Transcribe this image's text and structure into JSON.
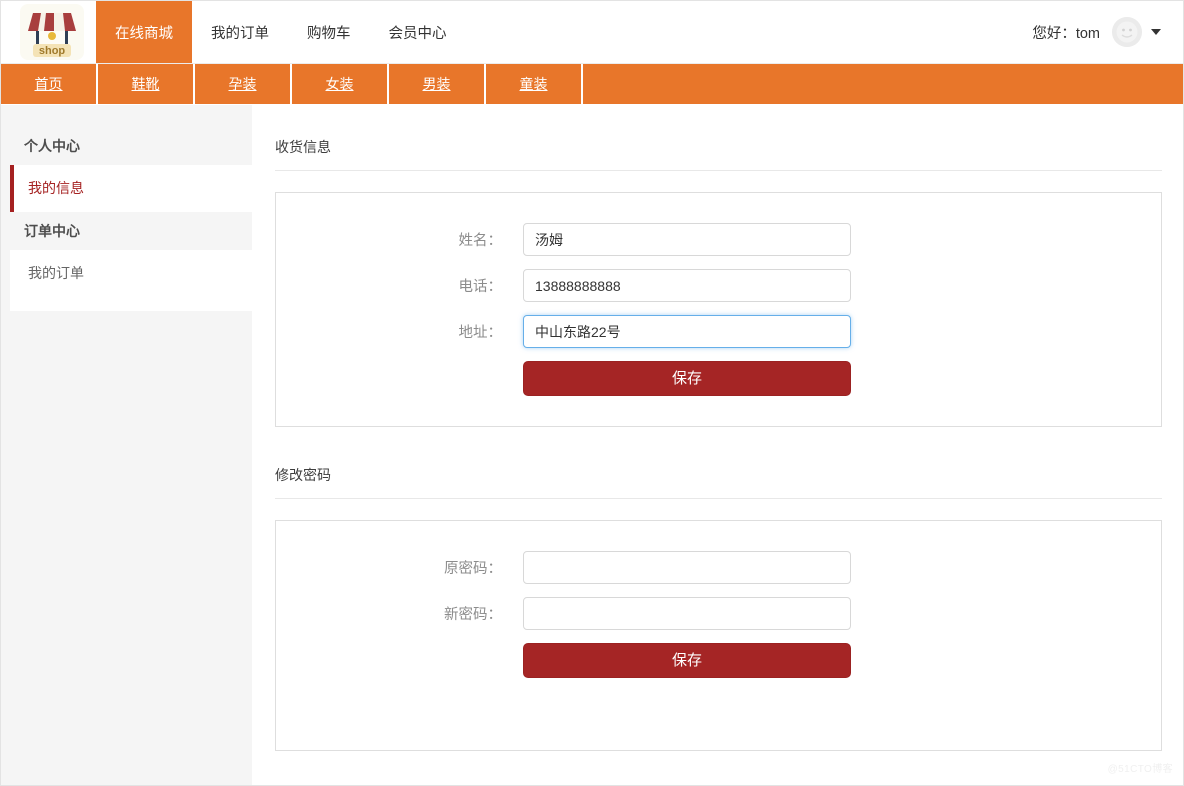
{
  "header": {
    "logo_alt": "shop",
    "logo_text": "shop",
    "nav": [
      {
        "label": "在线商城",
        "active": true
      },
      {
        "label": "我的订单",
        "active": false
      },
      {
        "label": "购物车",
        "active": false
      },
      {
        "label": "会员中心",
        "active": false
      }
    ],
    "greeting": "您好：tom",
    "username": "tom",
    "avatar_icon": "user-avatar-icon",
    "caret_icon": "chevron-down-icon"
  },
  "category_nav": {
    "items": [
      {
        "label": "首页"
      },
      {
        "label": "鞋靴"
      },
      {
        "label": "孕装"
      },
      {
        "label": "女装"
      },
      {
        "label": "男装"
      },
      {
        "label": "童装"
      }
    ]
  },
  "sidebar": {
    "groups": [
      {
        "title": "个人中心",
        "items": [
          {
            "label": "我的信息",
            "active": true
          }
        ]
      },
      {
        "title": "订单中心",
        "items": [
          {
            "label": "我的订单",
            "active": false
          }
        ]
      }
    ]
  },
  "main": {
    "shipping": {
      "title": "收货信息",
      "fields": [
        {
          "label": "姓名：",
          "value": "汤姆",
          "placeholder": "",
          "focused": false,
          "type": "text"
        },
        {
          "label": "电话：",
          "value": "13888888888",
          "placeholder": "",
          "focused": false,
          "type": "text"
        },
        {
          "label": "地址：",
          "value": "中山东路22号",
          "placeholder": "",
          "focused": true,
          "type": "text"
        }
      ],
      "save_label": "保存"
    },
    "password": {
      "title": "修改密码",
      "fields": [
        {
          "label": "原密码：",
          "value": "",
          "placeholder": "",
          "focused": false,
          "type": "password"
        },
        {
          "label": "新密码：",
          "value": "",
          "placeholder": "",
          "focused": false,
          "type": "password"
        }
      ],
      "save_label": "保存"
    }
  },
  "watermark": "@51CTO博客",
  "colors": {
    "brand_orange": "#e8762a",
    "accent_red": "#a52525",
    "sidebar_bg": "#f5f5f5",
    "focus_blue": "#66afe9"
  }
}
